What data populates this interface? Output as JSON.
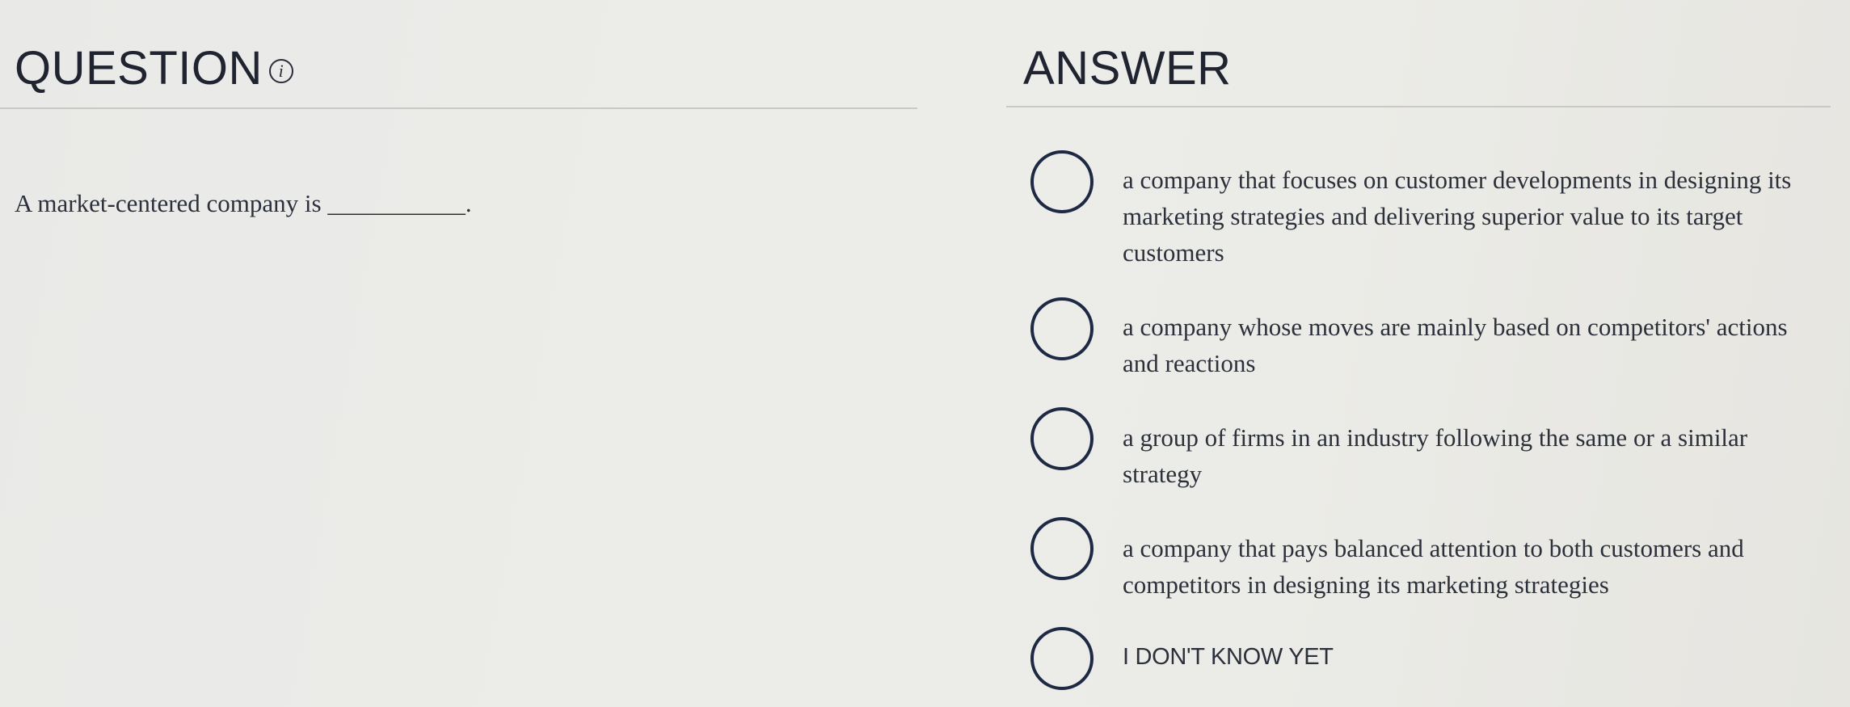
{
  "question": {
    "heading": "QUESTION",
    "info_icon": "info-icon",
    "text": "A market-centered company is ___________."
  },
  "answer": {
    "heading": "ANSWER",
    "options": [
      {
        "label": "a company that focuses on customer developments in designing its marketing strategies and delivering superior value to its target customers",
        "selected": false
      },
      {
        "label": "a company whose moves are mainly based on competitors' actions and reactions",
        "selected": false
      },
      {
        "label": "a group of firms in an industry following the same or a similar strategy",
        "selected": false
      },
      {
        "label": "a company that pays balanced attention to both customers and competitors in designing its marketing strategies",
        "selected": false
      },
      {
        "label": "I DON'T KNOW YET",
        "selected": false
      }
    ]
  }
}
